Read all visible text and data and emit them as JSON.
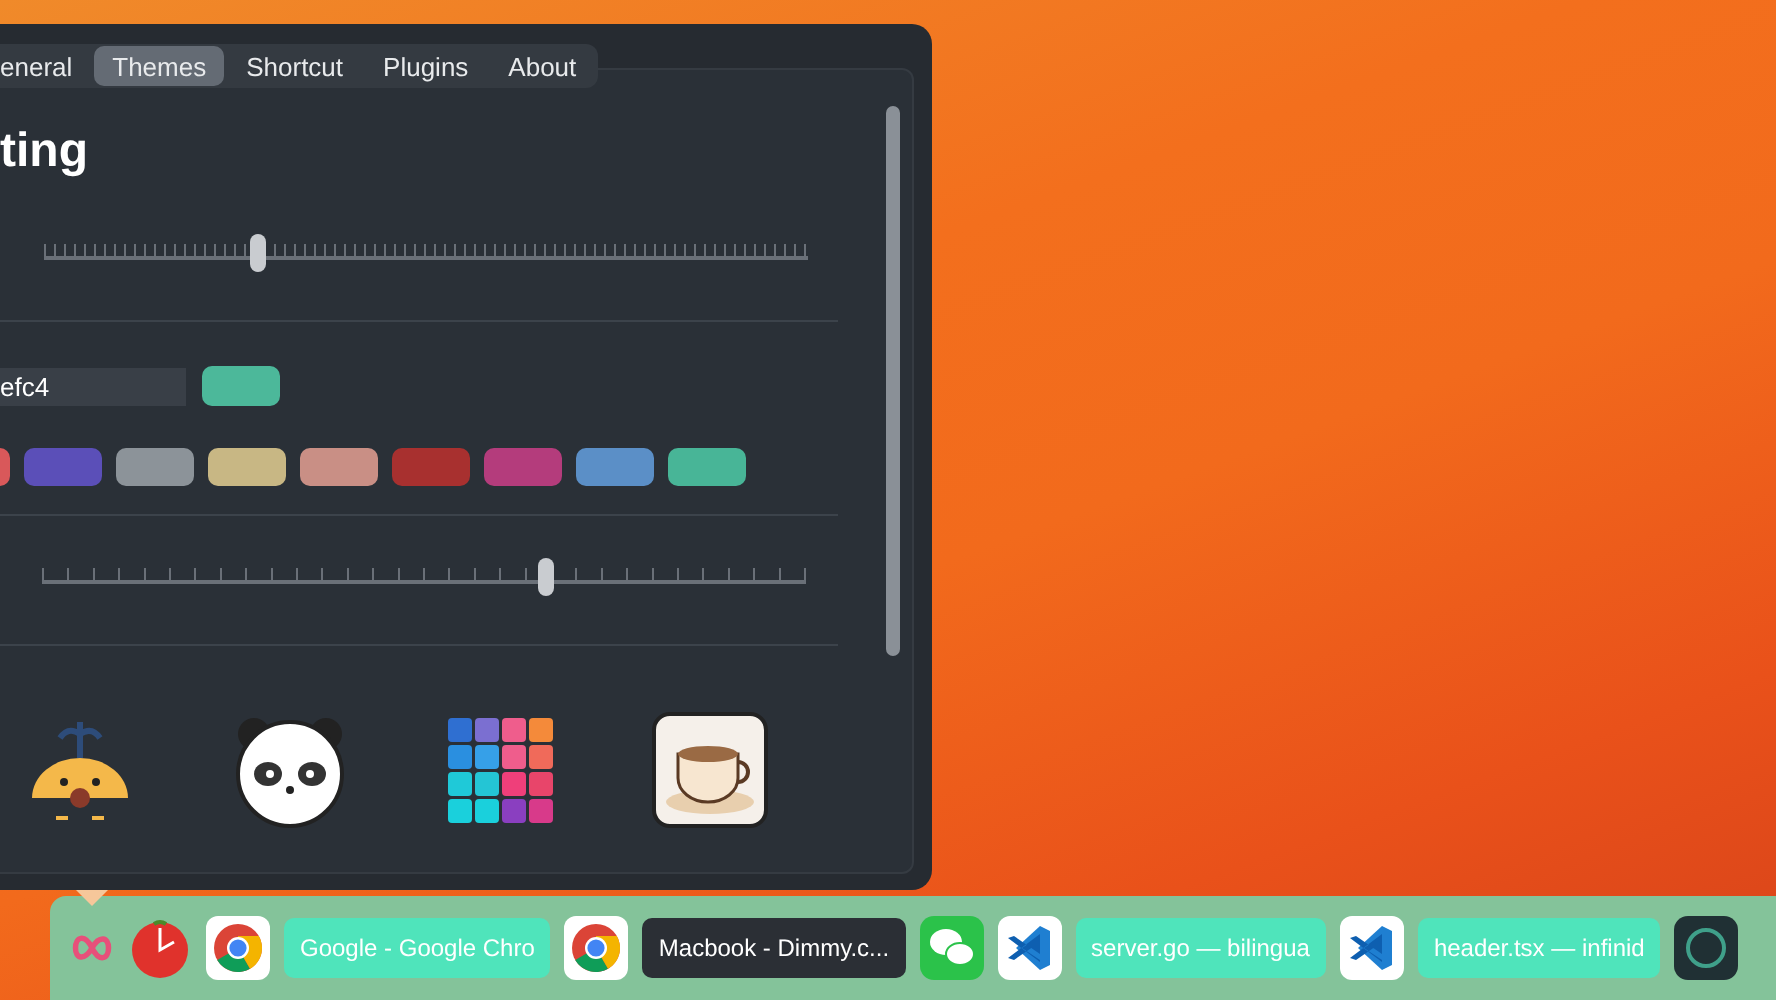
{
  "window": {
    "tabs": [
      {
        "label": "eneral",
        "selected": false
      },
      {
        "label": "Themes",
        "selected": true
      },
      {
        "label": "Shortcut",
        "selected": false
      },
      {
        "label": "Plugins",
        "selected": false
      },
      {
        "label": "About",
        "selected": false
      }
    ],
    "title": "ting",
    "slider_1": {
      "level": 0.28
    },
    "color_field": {
      "value": "efc4",
      "color": "#4cb89a"
    },
    "swatches": [
      {
        "color": "#d9585a"
      },
      {
        "color": "#5b4fb8"
      },
      {
        "color": "#8c9399"
      },
      {
        "color": "#c8b784"
      },
      {
        "color": "#c98f85"
      },
      {
        "color": "#a8302f"
      },
      {
        "color": "#b43c7c"
      },
      {
        "color": "#5b8fc7"
      },
      {
        "color": "#48b597"
      }
    ],
    "slider_2": {
      "level": 0.66
    },
    "icons": [
      {
        "kind": "whale"
      },
      {
        "kind": "panda"
      },
      {
        "kind": "grid"
      },
      {
        "kind": "coffee"
      }
    ]
  },
  "dock": {
    "items": [
      {
        "kind": "loop"
      },
      {
        "kind": "tomato"
      },
      {
        "kind": "chrome"
      },
      {
        "kind": "window",
        "label": "Google - Google Chro",
        "selected": false
      },
      {
        "kind": "chrome"
      },
      {
        "kind": "window",
        "label": "Macbook - Dimmy.c...",
        "selected": true
      },
      {
        "kind": "chat"
      },
      {
        "kind": "code"
      },
      {
        "kind": "window",
        "label": "server.go — bilingua",
        "selected": false
      },
      {
        "kind": "code"
      },
      {
        "kind": "window",
        "label": "header.tsx — infinid",
        "selected": false
      },
      {
        "kind": "dark"
      }
    ]
  }
}
